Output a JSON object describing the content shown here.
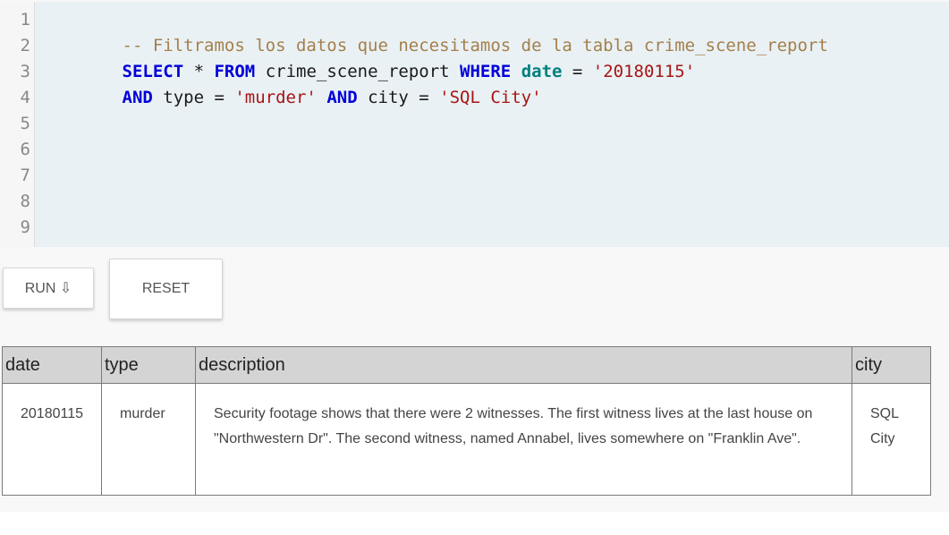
{
  "editor": {
    "line_numbers": [
      "1",
      "2",
      "3",
      "4",
      "5",
      "6",
      "7",
      "8",
      "9"
    ],
    "line1": {
      "comment": "-- Filtramos los datos que necesitamos de la tabla crime_scene_report"
    },
    "line2": {
      "kw_select": "SELECT",
      "star": " * ",
      "kw_from": "FROM",
      "table": " crime_scene_report ",
      "kw_where": "WHERE",
      "sp1": " ",
      "fn_date": "date",
      "eq": " = ",
      "str_date": "'20180115'"
    },
    "line3": {
      "kw_and1": "AND",
      "col_type": " type = ",
      "str_type": "'murder'",
      "sp2": " ",
      "kw_and2": "AND",
      "col_city": " city = ",
      "str_city": "'SQL City'"
    }
  },
  "buttons": {
    "run_label": "RUN ⇩",
    "reset_label": "RESET"
  },
  "results": {
    "columns": [
      "date",
      "type",
      "description",
      "city"
    ],
    "rows": [
      {
        "date": "20180115",
        "type": "murder",
        "description": "Security footage shows that there were 2 witnesses. The first witness lives at the last house on \"Northwestern Dr\". The second witness, named Annabel, lives somewhere on \"Franklin Ave\".",
        "city": "SQL City"
      }
    ]
  }
}
